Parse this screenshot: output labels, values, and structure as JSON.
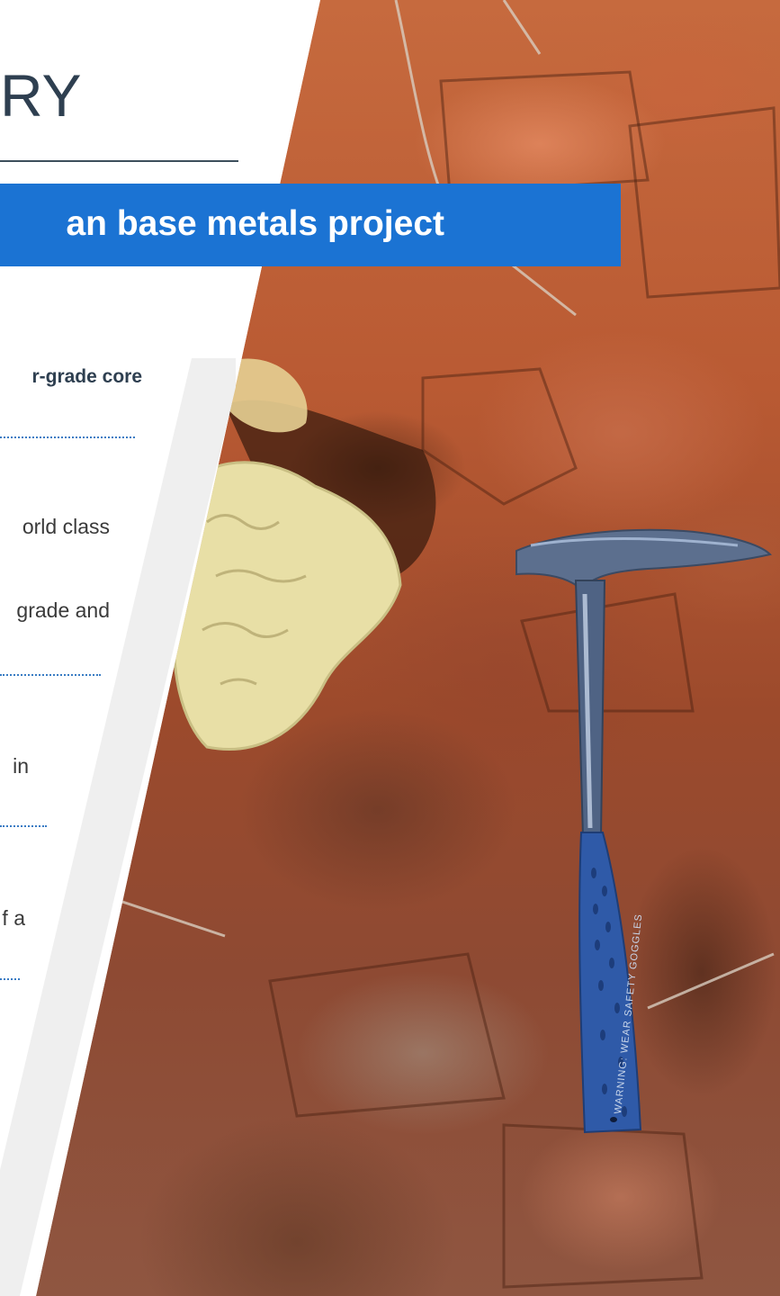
{
  "heading": {
    "title": "RY"
  },
  "banner": {
    "text": "an base metals project"
  },
  "lines": [
    {
      "text": "r-grade core"
    },
    {
      "text": "orld class"
    },
    {
      "text": "grade and"
    },
    {
      "text": "in"
    },
    {
      "text": "f a"
    }
  ],
  "photo": {
    "hammer_inscription": "WARNING: WEAR SAFETY GOGGLES"
  },
  "colors": {
    "banner_blue": "#1b73d3",
    "heading_text": "#2e3f50",
    "divider_dots": "#3a7cc4",
    "panel_gray": "#efefef"
  }
}
